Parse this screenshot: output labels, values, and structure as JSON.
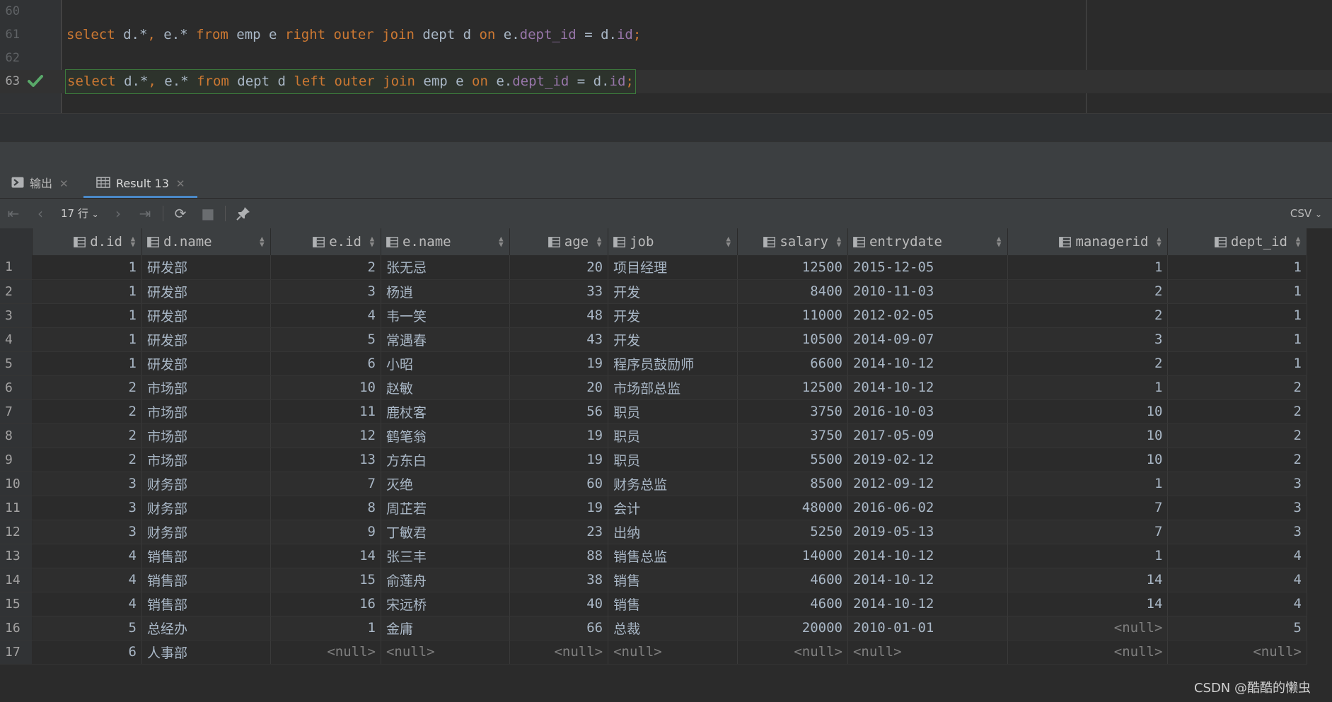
{
  "editor": {
    "lines": [
      {
        "num": "60",
        "tokens": []
      },
      {
        "num": "61",
        "tokens": [
          {
            "t": "select",
            "c": "kw"
          },
          {
            "t": " d.*",
            "c": ""
          },
          {
            "t": ",",
            "c": "kw"
          },
          {
            "t": " e.* ",
            "c": ""
          },
          {
            "t": "from",
            "c": "kw"
          },
          {
            "t": " emp e ",
            "c": ""
          },
          {
            "t": "right outer join",
            "c": "kw"
          },
          {
            "t": " dept d ",
            "c": ""
          },
          {
            "t": "on",
            "c": "kw"
          },
          {
            "t": " e.",
            "c": ""
          },
          {
            "t": "dept_id",
            "c": "fld"
          },
          {
            "t": " = d.",
            "c": ""
          },
          {
            "t": "id",
            "c": "fld"
          },
          {
            "t": ";",
            "c": "kw"
          }
        ]
      },
      {
        "num": "62",
        "tokens": []
      },
      {
        "num": "63",
        "tokens": [
          {
            "t": "select",
            "c": "kw"
          },
          {
            "t": " d.*",
            "c": ""
          },
          {
            "t": ",",
            "c": "kw"
          },
          {
            "t": " e.* ",
            "c": ""
          },
          {
            "t": "from",
            "c": "kw"
          },
          {
            "t": " dept d ",
            "c": ""
          },
          {
            "t": "left outer join",
            "c": "kw"
          },
          {
            "t": " emp e ",
            "c": ""
          },
          {
            "t": "on",
            "c": "kw"
          },
          {
            "t": " e.",
            "c": ""
          },
          {
            "t": "dept_id",
            "c": "fld"
          },
          {
            "t": " = d.",
            "c": ""
          },
          {
            "t": "id",
            "c": "fld"
          },
          {
            "t": ";",
            "c": "kw"
          }
        ]
      }
    ],
    "current_line_status_icon": "checkmark-icon"
  },
  "tabs": [
    {
      "label": "输出",
      "icon": "console-icon",
      "active": false
    },
    {
      "label": "Result 13",
      "icon": "table-icon",
      "active": true
    }
  ],
  "toolbar": {
    "rows_label": "17 行",
    "export_format": "CSV"
  },
  "grid": {
    "columns": [
      {
        "name": "d.id",
        "align": "num"
      },
      {
        "name": "d.name",
        "align": "txt"
      },
      {
        "name": "e.id",
        "align": "num"
      },
      {
        "name": "e.name",
        "align": "txt"
      },
      {
        "name": "age",
        "align": "num"
      },
      {
        "name": "job",
        "align": "txt"
      },
      {
        "name": "salary",
        "align": "num"
      },
      {
        "name": "entrydate",
        "align": "txt"
      },
      {
        "name": "managerid",
        "align": "num"
      },
      {
        "name": "dept_id",
        "align": "num"
      }
    ],
    "rows": [
      [
        "1",
        "研发部",
        "2",
        "张无忌",
        "20",
        "项目经理",
        "12500",
        "2015-12-05",
        "1",
        "1"
      ],
      [
        "1",
        "研发部",
        "3",
        "杨逍",
        "33",
        "开发",
        "8400",
        "2010-11-03",
        "2",
        "1"
      ],
      [
        "1",
        "研发部",
        "4",
        "韦一笑",
        "48",
        "开发",
        "11000",
        "2012-02-05",
        "2",
        "1"
      ],
      [
        "1",
        "研发部",
        "5",
        "常遇春",
        "43",
        "开发",
        "10500",
        "2014-09-07",
        "3",
        "1"
      ],
      [
        "1",
        "研发部",
        "6",
        "小昭",
        "19",
        "程序员鼓励师",
        "6600",
        "2014-10-12",
        "2",
        "1"
      ],
      [
        "2",
        "市场部",
        "10",
        "赵敏",
        "20",
        "市场部总监",
        "12500",
        "2014-10-12",
        "1",
        "2"
      ],
      [
        "2",
        "市场部",
        "11",
        "鹿杖客",
        "56",
        "职员",
        "3750",
        "2016-10-03",
        "10",
        "2"
      ],
      [
        "2",
        "市场部",
        "12",
        "鹤笔翁",
        "19",
        "职员",
        "3750",
        "2017-05-09",
        "10",
        "2"
      ],
      [
        "2",
        "市场部",
        "13",
        "方东白",
        "19",
        "职员",
        "5500",
        "2019-02-12",
        "10",
        "2"
      ],
      [
        "3",
        "财务部",
        "7",
        "灭绝",
        "60",
        "财务总监",
        "8500",
        "2012-09-12",
        "1",
        "3"
      ],
      [
        "3",
        "财务部",
        "8",
        "周芷若",
        "19",
        "会计",
        "48000",
        "2016-06-02",
        "7",
        "3"
      ],
      [
        "3",
        "财务部",
        "9",
        "丁敏君",
        "23",
        "出纳",
        "5250",
        "2019-05-13",
        "7",
        "3"
      ],
      [
        "4",
        "销售部",
        "14",
        "张三丰",
        "88",
        "销售总监",
        "14000",
        "2014-10-12",
        "1",
        "4"
      ],
      [
        "4",
        "销售部",
        "15",
        "俞莲舟",
        "38",
        "销售",
        "4600",
        "2014-10-12",
        "14",
        "4"
      ],
      [
        "4",
        "销售部",
        "16",
        "宋远桥",
        "40",
        "销售",
        "4600",
        "2014-10-12",
        "14",
        "4"
      ],
      [
        "5",
        "总经办",
        "1",
        "金庸",
        "66",
        "总裁",
        "20000",
        "2010-01-01",
        "<null>",
        "5"
      ],
      [
        "6",
        "人事部",
        "<null>",
        "<null>",
        "<null>",
        "<null>",
        "<null>",
        "<null>",
        "<null>",
        "<null>"
      ]
    ]
  },
  "watermark": "CSDN @酷酷的懒虫",
  "colors": {
    "keyword": "#cc7832",
    "field": "#9876aa",
    "text": "#a9b7c6",
    "null": "#7f7f7f",
    "active_tab": "#4a88c7",
    "success_check": "#59a869"
  }
}
